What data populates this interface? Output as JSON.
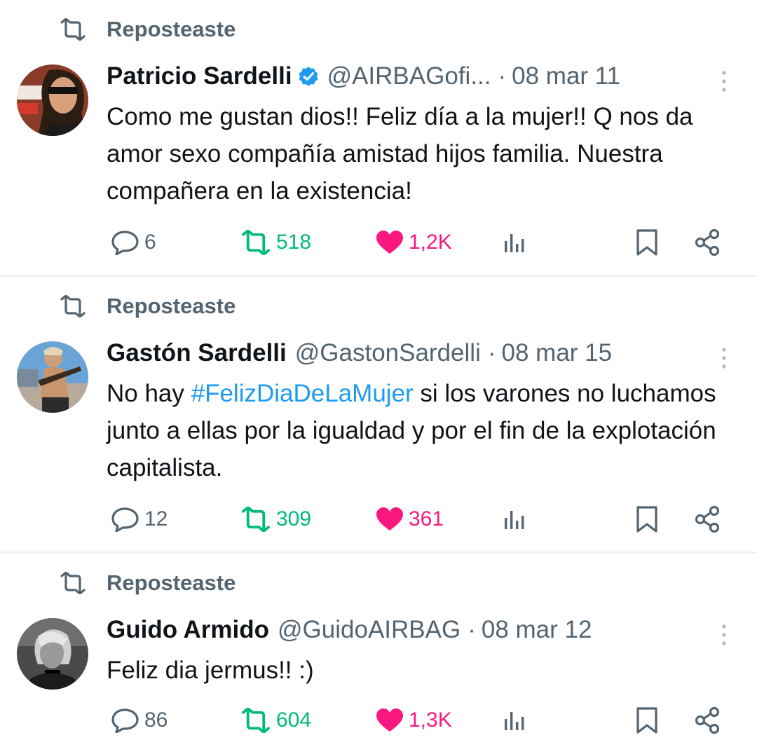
{
  "repost_label": "Reposteaste",
  "tweets": [
    {
      "name": "Patricio Sardelli",
      "handle": "@AIRBAGofi...",
      "separator": "·",
      "time": "08 mar 11",
      "text": "Como me gustan dios!! Feliz día a la mujer!! Q nos da amor sexo compañía amistad hijos familia. Nuestra compañera en la existencia!",
      "verified": true,
      "stats": {
        "replies": "6",
        "reposts": "518",
        "likes": "1,2K"
      }
    },
    {
      "name": "Gastón Sardelli",
      "handle": "@GastonSardelli",
      "separator": "·",
      "time": "08 mar 15",
      "text_before": "No hay ",
      "hashtag": "#FelizDiaDeLaMujer",
      "text_after": " si los varones no luchamos junto a ellas por la igualdad y por el fin de la explotación capitalista.",
      "verified": false,
      "stats": {
        "replies": "12",
        "reposts": "309",
        "likes": "361"
      }
    },
    {
      "name": "Guido Armido",
      "handle": "@GuidoAIRBAG",
      "separator": "·",
      "time": "08 mar 12",
      "text": "Feliz dia jermus!! :)",
      "verified": false,
      "stats": {
        "replies": "86",
        "reposts": "604",
        "likes": "1,3K"
      }
    }
  ],
  "icons": {
    "repost": "repost-icon",
    "reply": "reply-icon",
    "like": "heart-icon",
    "views": "views-icon",
    "bookmark": "bookmark-icon",
    "share": "share-icon",
    "more": "more-icon",
    "verified": "verified-badge-icon"
  },
  "colors": {
    "secondary_text": "#536471",
    "repost_green": "#00ba7c",
    "like_pink": "#f91880",
    "hashtag_blue": "#1d9bf0",
    "verified_blue": "#1d9bf0"
  }
}
